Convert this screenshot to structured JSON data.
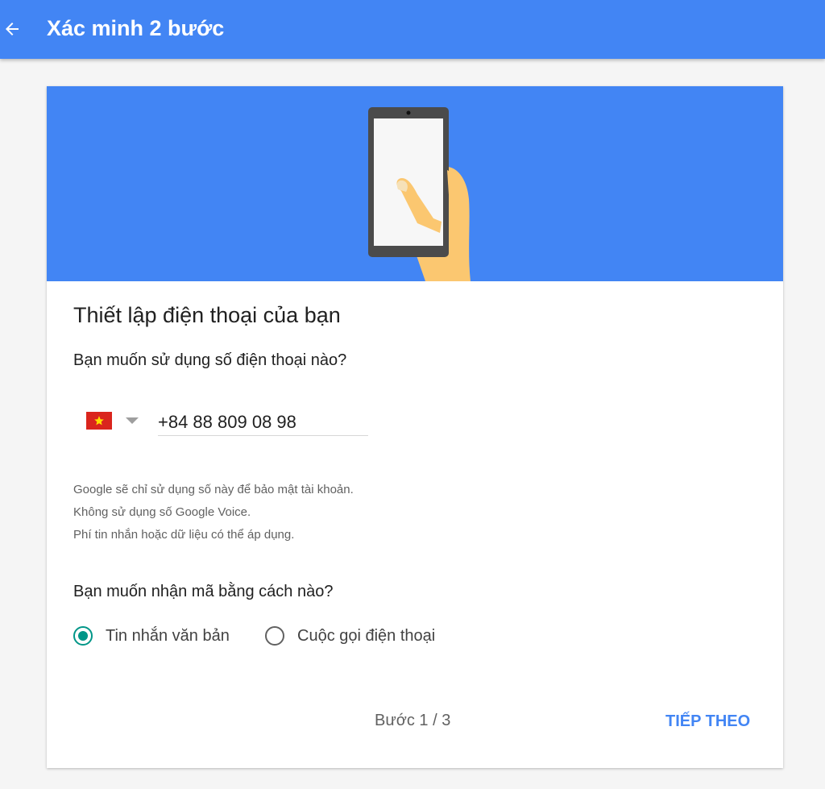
{
  "appbar": {
    "title": "Xác minh 2 bước",
    "back_icon": "arrow-back-icon",
    "color": "#4285f4"
  },
  "card": {
    "title": "Thiết lập điện thoại của bạn",
    "phone_question": "Bạn muốn sử dụng số điện thoại nào?",
    "country": {
      "flag_icon": "vietnam-flag-icon",
      "dropdown_icon": "caret-down-icon"
    },
    "phone_input": {
      "value": "+84 88 809 08 98"
    },
    "notes": [
      "Google sẽ chỉ sử dụng số này để bảo mật tài khoản.",
      "Không sử dụng số Google Voice.",
      "Phí tin nhắn hoặc dữ liệu có thể áp dụng."
    ],
    "method_question": "Bạn muốn nhận mã bằng cách nào?",
    "methods": [
      {
        "label": "Tin nhắn văn bản",
        "selected": true
      },
      {
        "label": "Cuộc gọi điện thoại",
        "selected": false
      }
    ],
    "step": "Bước 1 / 3",
    "next_label": "TIẾP THEO",
    "accent": "#009688"
  }
}
